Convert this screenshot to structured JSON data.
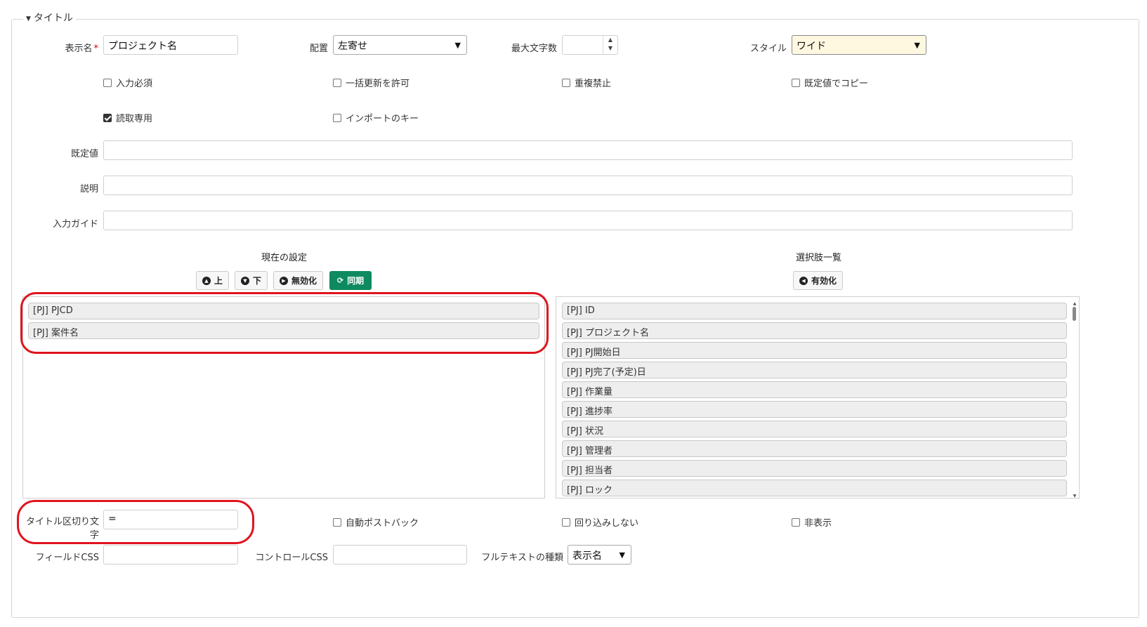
{
  "section": {
    "title": "タイトル"
  },
  "display_name": {
    "label": "表示名",
    "required_mark": "*",
    "value": "プロジェクト名"
  },
  "alignment": {
    "label": "配置",
    "value": "左寄せ"
  },
  "max_length": {
    "label": "最大文字数",
    "value": ""
  },
  "style": {
    "label": "スタイル",
    "value": "ワイド"
  },
  "checkboxes": {
    "required": {
      "label": "入力必須",
      "checked": false
    },
    "bulk_update": {
      "label": "一括更新を許可",
      "checked": false
    },
    "no_duplicate": {
      "label": "重複禁止",
      "checked": false
    },
    "copy_default": {
      "label": "既定値でコピー",
      "checked": false
    },
    "read_only": {
      "label": "読取専用",
      "checked": true
    },
    "import_key": {
      "label": "インポートのキー",
      "checked": false
    },
    "auto_postback": {
      "label": "自動ポストバック",
      "checked": false
    },
    "no_wrap": {
      "label": "回り込みしない",
      "checked": false
    },
    "hidden": {
      "label": "非表示",
      "checked": false
    }
  },
  "default_value": {
    "label": "既定値",
    "value": ""
  },
  "description": {
    "label": "説明",
    "value": ""
  },
  "input_guide": {
    "label": "入力ガイド",
    "value": ""
  },
  "current_settings": {
    "heading": "現在の設定",
    "buttons": {
      "up": "上",
      "down": "下",
      "disable": "無効化",
      "sync": "同期"
    },
    "items": [
      "[PJ] PJCD",
      "[PJ] 案件名"
    ]
  },
  "choices": {
    "heading": "選択肢一覧",
    "buttons": {
      "enable": "有効化"
    },
    "items": [
      "[PJ] ID",
      "[PJ] プロジェクト名",
      "[PJ] PJ開始日",
      "[PJ] PJ完了(予定)日",
      "[PJ] 作業量",
      "[PJ] 進捗率",
      "[PJ] 状況",
      "[PJ] 管理者",
      "[PJ] 担当者",
      "[PJ] ロック"
    ]
  },
  "title_separator": {
    "label_line1": "タイトル区切り文",
    "label_line2": "字",
    "value": "="
  },
  "field_css": {
    "label": "フィールドCSS",
    "value": ""
  },
  "control_css": {
    "label": "コントロールCSS",
    "value": ""
  },
  "fulltext_type": {
    "label": "フルテキストの種類",
    "value": "表示名"
  },
  "colors": {
    "accent_green": "#0e8a60",
    "highlight_red": "#e0141e",
    "style_select_bg": "#fff8e1"
  }
}
